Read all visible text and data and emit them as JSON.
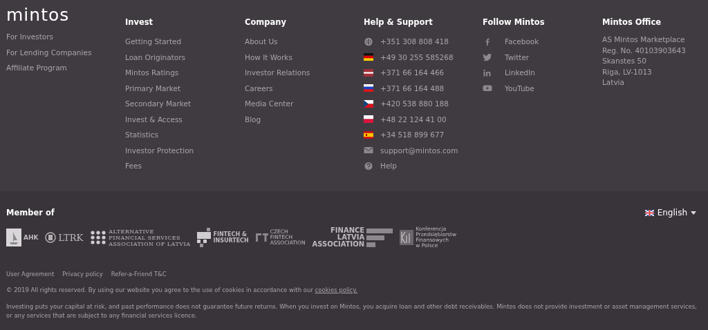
{
  "logo": {
    "text": "mintos"
  },
  "audience_links": [
    "For Investors",
    "For Lending Companies",
    "Affiliate Program"
  ],
  "columns": [
    {
      "title": "Invest",
      "links": [
        "Getting Started",
        "Loan Originators",
        "Mintos Ratings",
        "Primary Market",
        "Secondary Market",
        "Invest & Access",
        "Statistics",
        "Investor Protection",
        "Fees"
      ]
    },
    {
      "title": "Company",
      "links": [
        "About Us",
        "How It Works",
        "Investor Relations",
        "Careers",
        "Media Center",
        "Blog"
      ]
    }
  ],
  "support": {
    "title": "Help & Support",
    "items": [
      {
        "kind": "globe",
        "text": "+351 308 808 418"
      },
      {
        "kind": "de",
        "text": "+49 30 255 585268"
      },
      {
        "kind": "lv",
        "text": "+371 66 164 466"
      },
      {
        "kind": "ru",
        "text": "+371 66 164 488"
      },
      {
        "kind": "cz",
        "text": "+420 538 880 188"
      },
      {
        "kind": "pl",
        "text": "+48 22 124 41 00"
      },
      {
        "kind": "es",
        "text": "+34 518 899 677"
      },
      {
        "kind": "mail",
        "text": "support@mintos.com"
      },
      {
        "kind": "help",
        "text": "Help"
      }
    ]
  },
  "social": {
    "title": "Follow Mintos",
    "items": [
      {
        "kind": "facebook",
        "text": "Facebook"
      },
      {
        "kind": "twitter",
        "text": "Twitter"
      },
      {
        "kind": "linkedin",
        "text": "LinkedIn"
      },
      {
        "kind": "youtube",
        "text": "YouTube"
      }
    ]
  },
  "office": {
    "title": "Mintos Office",
    "lines": [
      "AS Mintos Marketplace",
      "Reg. No. 40103903643",
      "Skanstes 50",
      "Riga, LV-1013",
      "Latvia"
    ]
  },
  "members": {
    "title": "Member of",
    "logos": [
      {
        "kind": "ahk",
        "lines": [
          "AHK"
        ]
      },
      {
        "kind": "ltrk",
        "lines": [
          "LTRK"
        ]
      },
      {
        "kind": "dots",
        "lines": [
          "ALTERNATIVE",
          "FINANCIAL SERVICES",
          "ASSOCIATION OF LATVIA"
        ]
      },
      {
        "kind": "pixels",
        "lines": [
          "FINTECH &",
          "INSURTECH"
        ]
      },
      {
        "kind": "ft",
        "lines": [
          "CZECH",
          "FINTECH",
          "ASSOCIATION"
        ]
      },
      {
        "kind": "bars",
        "lines": [
          "FINANCE",
          "LATVIA",
          "ASSOCIATION"
        ]
      },
      {
        "kind": "kpf",
        "lines": [
          "Konferencja",
          "Przedsiębiorstw",
          "Finansowych",
          "w Polsce"
        ]
      }
    ]
  },
  "language": {
    "label": "English"
  },
  "legal_links": [
    "User Agreement",
    "Privacy policy",
    "Refer-a-Friend T&C"
  ],
  "copyright": {
    "text": "© 2019 All rights reserved. By using our website you agree to the use of cookies in accordance with our",
    "link": "cookies policy."
  },
  "disclaimer": "Investing puts your capital at risk, and past performance does not guarantee future returns. When you invest on Mintos, you acquire loan and other debt receivables. Mintos does not provide investment or asset management services, or any services that are subject to any financial services licence."
}
